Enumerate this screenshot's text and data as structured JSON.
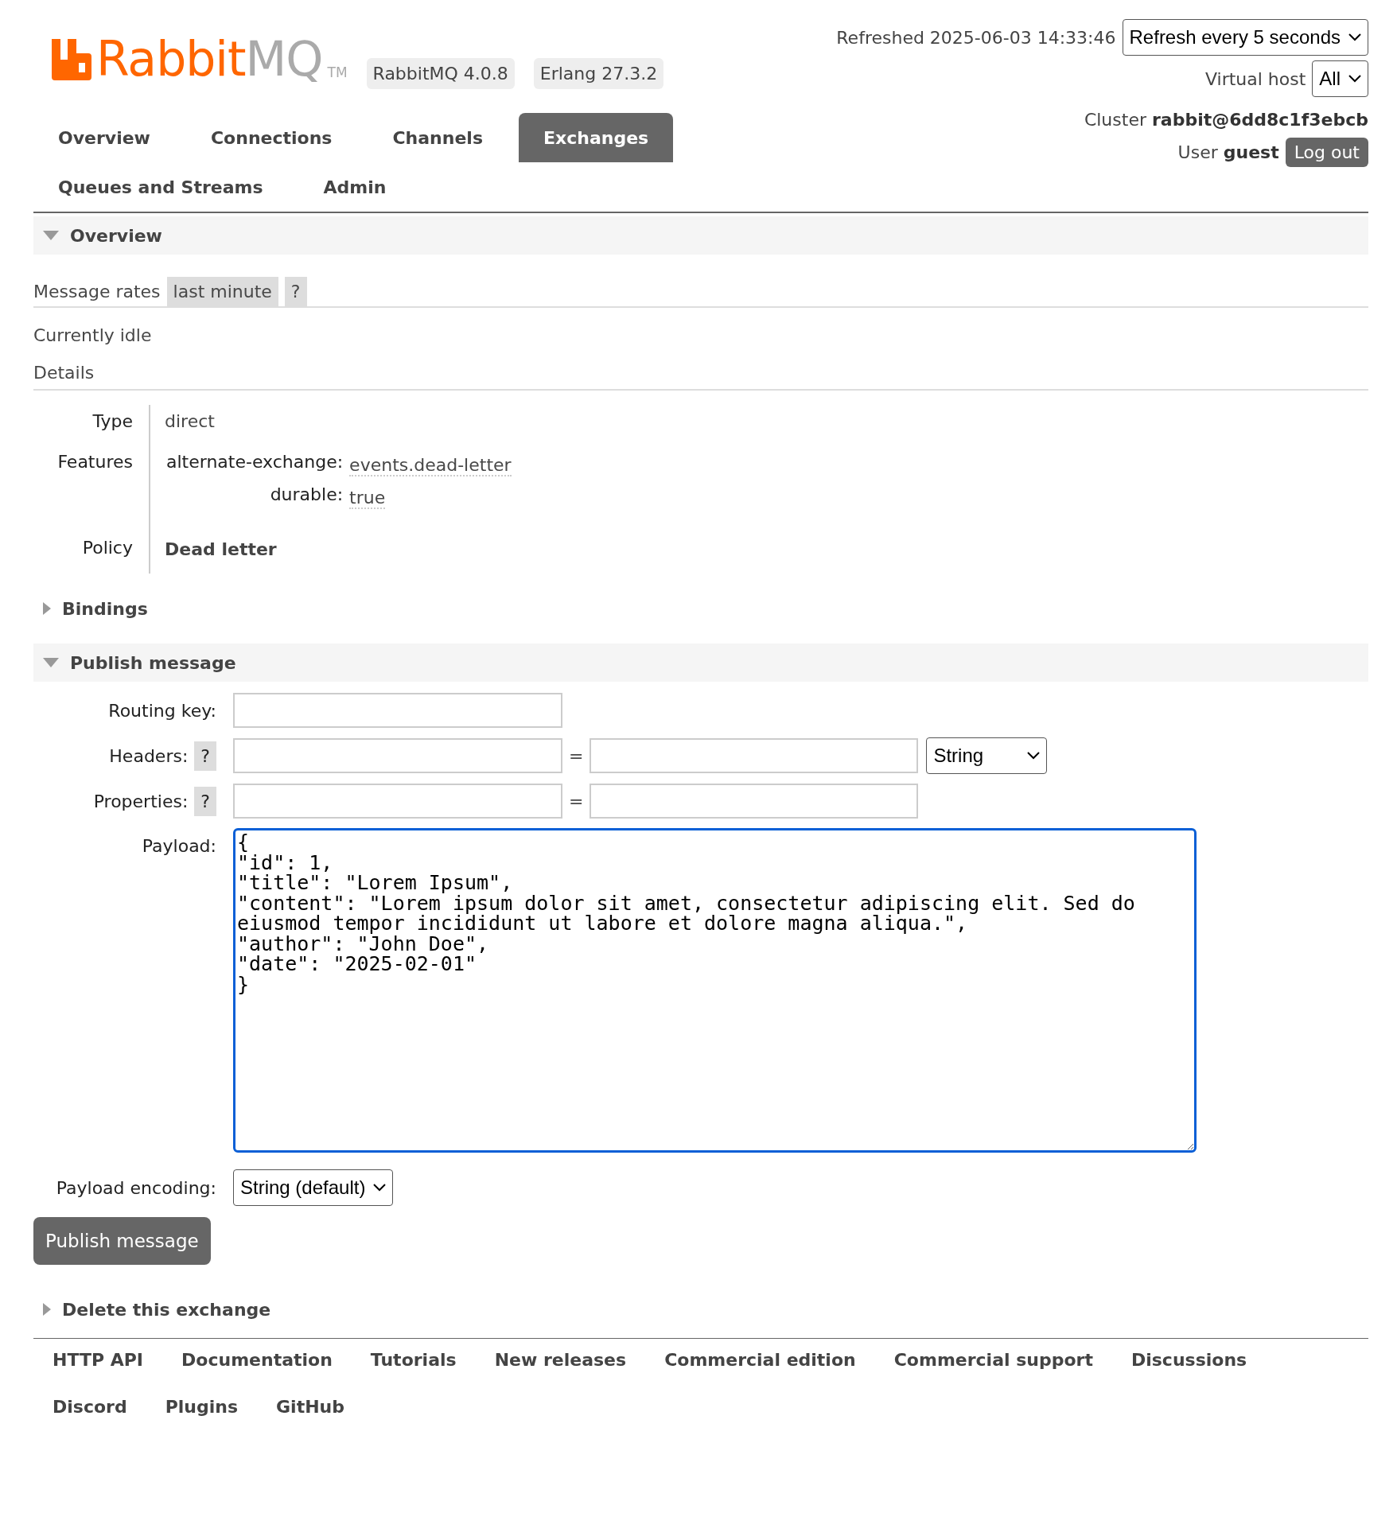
{
  "header": {
    "logo": {
      "brand": "Rabbit",
      "suffix": "MQ",
      "tm": "TM"
    },
    "badges": [
      "RabbitMQ 4.0.8",
      "Erlang 27.3.2"
    ],
    "refreshed": "Refreshed 2025-06-03 14:33:46",
    "refresh_select": "Refresh every 5 seconds",
    "vhost_label": "Virtual host",
    "vhost_select": "All",
    "cluster_label": "Cluster",
    "cluster": "rabbit@6dd8c1f3ebcb",
    "user_label": "User",
    "user": "guest",
    "logout": "Log out"
  },
  "tabs": [
    {
      "label": "Overview",
      "selected": false
    },
    {
      "label": "Connections",
      "selected": false
    },
    {
      "label": "Channels",
      "selected": false
    },
    {
      "label": "Exchanges",
      "selected": true
    },
    {
      "label": "Queues and Streams",
      "selected": false
    },
    {
      "label": "Admin",
      "selected": false
    }
  ],
  "overview": {
    "title": "Overview",
    "expanded": true,
    "rates_label": "Message rates",
    "rates_period": "last minute",
    "help": "?",
    "status": "Currently idle",
    "details_title": "Details",
    "details": [
      {
        "label": "Type",
        "kind": "text",
        "value": "direct"
      },
      {
        "label": "Features",
        "kind": "features",
        "items": [
          {
            "key": "alternate-exchange:",
            "value": "events.dead-letter"
          },
          {
            "key": "durable:",
            "value": "true"
          }
        ]
      },
      {
        "label": "Policy",
        "kind": "bold",
        "value": "Dead letter"
      }
    ]
  },
  "bindings": {
    "title": "Bindings",
    "expanded": false
  },
  "publish": {
    "title": "Publish message",
    "expanded": true,
    "routing_key_label": "Routing key:",
    "headers_label": "Headers:",
    "headers_help": "?",
    "headers_eq": "=",
    "headers_type": "String",
    "properties_label": "Properties:",
    "properties_help": "?",
    "properties_eq": "=",
    "payload_label": "Payload:",
    "payload": "{\n\"id\": 1,\n\"title\": \"Lorem Ipsum\",\n\"content\": \"Lorem ipsum dolor sit amet, consectetur adipiscing elit. Sed do eiusmod tempor incididunt ut labore et dolore magna aliqua.\",\n\"author\": \"John Doe\",\n\"date\": \"2025-02-01\"\n}",
    "encoding_label": "Payload encoding:",
    "encoding": "String (default)",
    "button": "Publish message"
  },
  "delete": {
    "title": "Delete this exchange",
    "expanded": false
  },
  "footer": {
    "links": [
      "HTTP API",
      "Documentation",
      "Tutorials",
      "New releases",
      "Commercial edition",
      "Commercial support",
      "Discussions",
      "Discord",
      "Plugins",
      "GitHub"
    ]
  }
}
